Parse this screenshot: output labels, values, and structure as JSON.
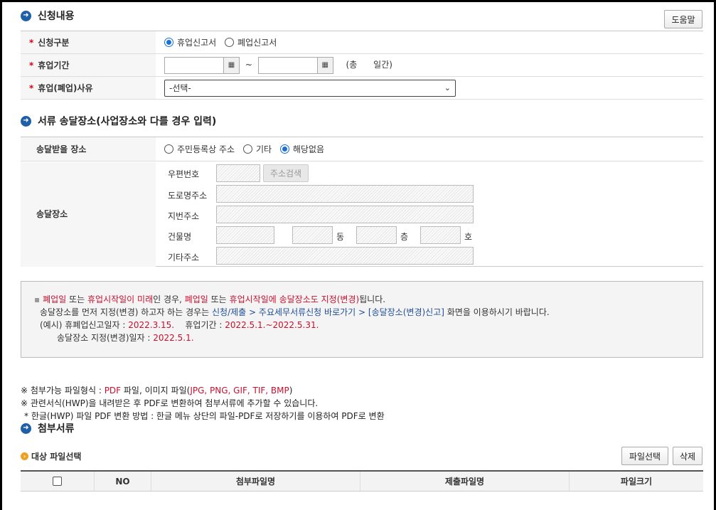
{
  "section1": {
    "title": "신청내용",
    "help_button": "도움말"
  },
  "form": {
    "type_label": "신청구분",
    "type_options": [
      "휴업신고서",
      "폐업신고서"
    ],
    "period_label": "휴업기간",
    "period_tilde": "~",
    "period_total": "(총      일간)",
    "reason_label": "휴업(폐업)사유",
    "reason_selected": "-선택-"
  },
  "section2": {
    "title": "서류 송달장소(사업장소와 다를 경우 입력)"
  },
  "delivery": {
    "receive_label": "송달받을 장소",
    "receive_options": [
      "주민등록상 주소",
      "기타",
      "해당없음"
    ],
    "place_label": "송달장소",
    "zip_label": "우편번호",
    "search_button": "주소검색",
    "road_label": "도로명주소",
    "lot_label": "지번주소",
    "building_label": "건물명",
    "dong": "동",
    "floor": "층",
    "ho": "호",
    "other_label": "기타주소"
  },
  "notice": {
    "l1_a": "폐업일",
    "l1_b": " 또는 ",
    "l1_c": "휴업시작일이 미래",
    "l1_d": "인 경우, ",
    "l1_e": "폐업일",
    "l1_f": " 또는 ",
    "l1_g": "휴업시작일에 송달장소도 지정(변경)",
    "l1_h": "됩니다.",
    "l2_a": "송달장소를 먼저 지정(변경) 하고자 하는 경우는 ",
    "l2_b": "신청/제출 > 주요세무서류신청 바로가기 > [송달장소(변경)신고]",
    "l2_c": " 화면을 이용하시기 바랍니다.",
    "l3_a": "(예시) 휴폐업신고일자 : ",
    "l3_b": "2022.3.15.",
    "l3_c": "    휴업기간 : ",
    "l3_d": "2022.5.1.~2022.5.31.",
    "l4_a": "송달장소 지정(변경)일자 : ",
    "l4_b": "2022.5.1."
  },
  "info": {
    "i1_a": "※ 첨부가능 파일형식 : ",
    "i1_b": "PDF",
    "i1_c": " 파일, 이미지 파일(",
    "i1_d": "JPG, PNG, GIF, TIF, BMP",
    "i1_e": ")",
    "i2": "※ 관련서식(HWP)을 내려받은 후 PDF로 변환하여 첨부서류에 추가할 수 있습니다.",
    "i3": "* 한글(HWP) 파일 PDF 변환 방법 : 한글 메뉴 상단의 파일-PDF로 저장하기를 이용하여 PDF로 변환"
  },
  "section3": {
    "title": "첨부서류",
    "sub_title": "대상 파일선택",
    "file_button": "파일선택",
    "delete_button": "삭제"
  },
  "grid": {
    "columns": [
      "NO",
      "첨부파일명",
      "제출파일명",
      "파일크기"
    ]
  },
  "colors": {
    "accent": "#1f5fa8",
    "required": "#d0021b",
    "highlight_red": "#c8102e",
    "link_blue": "#1f4e9a"
  }
}
